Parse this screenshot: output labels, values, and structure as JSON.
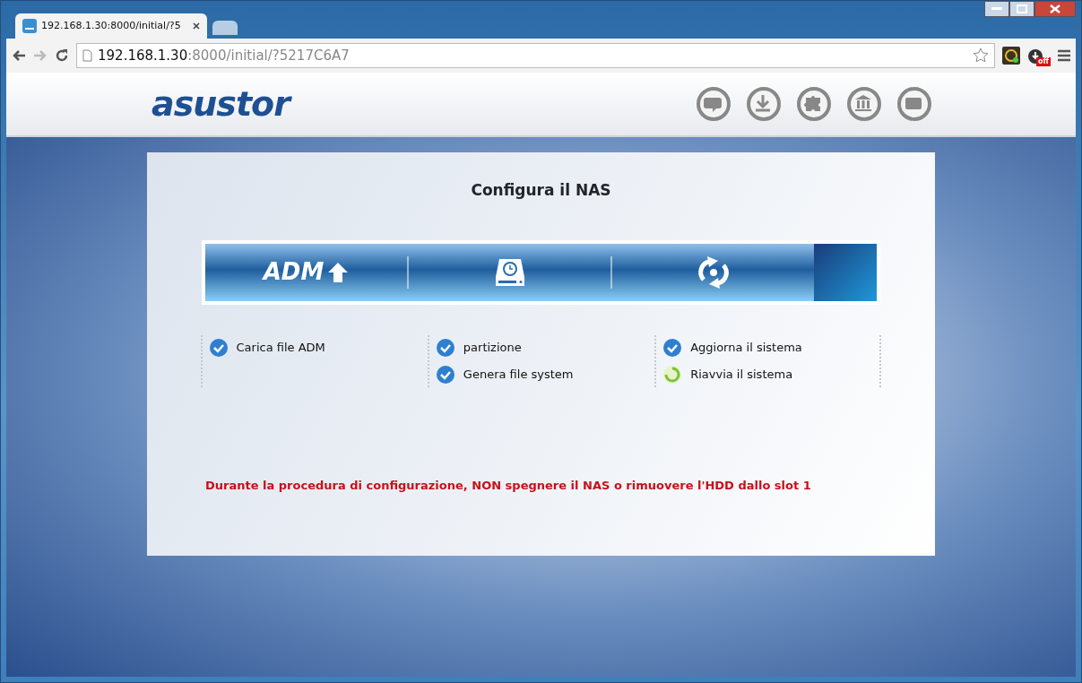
{
  "browser": {
    "tabs": [
      {
        "title": "192.168.1.30:8000/initial/?5",
        "selected": true
      }
    ],
    "address": {
      "host": "192.168.1.30",
      "rest": ":8000/initial/?5217C6A7"
    },
    "extension_badge": "off"
  },
  "header": {
    "logo": "asustor"
  },
  "dialog": {
    "title": "Configura il NAS",
    "banner_logo": "ADM",
    "steps": [
      {
        "items": [
          {
            "label": "Carica file ADM",
            "completed": true
          }
        ]
      },
      {
        "items": [
          {
            "label": "partizione",
            "completed": true
          },
          {
            "label": "Genera file system",
            "completed": true
          }
        ]
      },
      {
        "items": [
          {
            "label": "Aggiorna il sistema",
            "completed": true
          },
          {
            "label": "Riavvia il sistema",
            "completed": false
          }
        ]
      }
    ],
    "warning": "Durante la procedura di configurazione, NON spegnere il NAS o rimuovere l'HDD dallo slot 1"
  }
}
